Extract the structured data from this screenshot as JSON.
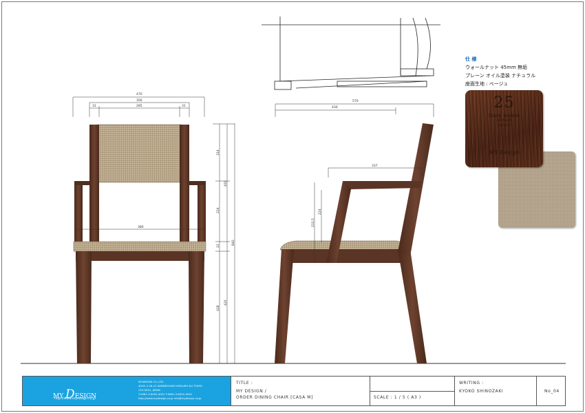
{
  "dimensions": {
    "front_total_width": "470",
    "front_inner_width": "356",
    "front_left_post": "31",
    "front_back_width": "285",
    "front_right_post": "31",
    "front_seat_width": "380",
    "side_total_depth": "570",
    "side_seat_depth": "430",
    "side_arm_length": "337",
    "height_back": "314",
    "height_total_upper": "450",
    "height_arm": "224",
    "height_seat_thick": "22",
    "height_total": "840",
    "height_seat_upper": "418",
    "height_seat_lower": "420",
    "side_arm_height": "231.5",
    "side_arm_height2": "224"
  },
  "spec": {
    "title": "仕 様",
    "line1": "ウォールナット  45mm  無垢",
    "line2": "プレーン オイル塗装  ナチュラル",
    "line3": "座面生地 : ベージュ"
  },
  "swatch": {
    "code": "25",
    "name_line1": "black walnut",
    "name_line2": "oil finish",
    "name_line3": "natural",
    "logo": "MY Design"
  },
  "title_block": {
    "brand_my": "MY",
    "brand_big": "D",
    "brand_rest": "ESIGN",
    "url": "http://www.mydesign.co.jp",
    "company_name": "MYDESIGN CO.,LTD.",
    "company_address1": "#202 2-26-12 KAMIMEGURO MEGURO-KU TOKYO",
    "company_address2": "153-0051, JAPAN",
    "company_tel": "T.0081-3-6452-4021   F.0081-3-6452-4022",
    "company_web": "http://www.mydesign.co.jp   info@mydesign.co.jp",
    "title_label": "TITLE :",
    "title_line1": "MY DESIGN /",
    "title_line2": "ORDER DINING CHAIR  [CASA M]",
    "scale": "SCALE : 1 / 5 ( A3 )",
    "writing_label": "WRITING :",
    "writer": "KYOKO SHINOZAKI",
    "sheet_no": "No_04"
  },
  "colors": {
    "wood": "#5a3424",
    "fabric": "#b8a68a",
    "logo_blue": "#1aa3e0"
  }
}
